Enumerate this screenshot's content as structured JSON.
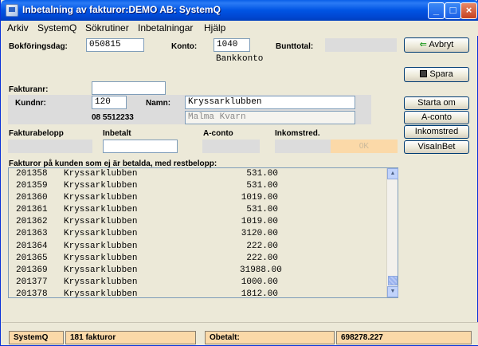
{
  "window": {
    "title": "Inbetalning av fakturor:DEMO AB: SystemQ"
  },
  "menu": [
    {
      "label": "Arkiv"
    },
    {
      "label": "SystemQ"
    },
    {
      "label": "Sökrutiner"
    },
    {
      "label": "Inbetalningar"
    },
    {
      "label": "Hjälp"
    }
  ],
  "form": {
    "bokforingsdag_label": "Bokföringsdag:",
    "bokforingsdag_value": "050815",
    "konto_label": "Konto:",
    "konto_value": "1040",
    "konto_name": "Bankkonto",
    "bunttotal_label": "Bunttotal:",
    "fakturanr_label": "Fakturanr:",
    "fakturanr_value": "",
    "kundnr_label": "Kundnr:",
    "kundnr_value": "120",
    "phone": "08 5512233",
    "namn_label": "Namn:",
    "namn_value": "Kryssarklubben",
    "address": "Malma Kvarn",
    "fakturabelopp_label": "Fakturabelopp",
    "inbetalt_label": "Inbetalt",
    "aconto_label": "A-conto",
    "inkomstred_label": "Inkomstred.",
    "ok_label": "0K"
  },
  "buttons": {
    "avbryt": "Avbryt",
    "spara": "Spara",
    "starta_om": "Starta om",
    "a_conto": "A-conto",
    "inkomstred": "Inkomstred",
    "visa_inbet": "VisaInBet"
  },
  "list": {
    "label": "Fakturor på kunden som ej är betalda, med restbelopp:",
    "rows": [
      [
        "201358",
        "Kryssarklubben",
        "531.00"
      ],
      [
        "201359",
        "Kryssarklubben",
        "531.00"
      ],
      [
        "201360",
        "Kryssarklubben",
        "1019.00"
      ],
      [
        "201361",
        "Kryssarklubben",
        "531.00"
      ],
      [
        "201362",
        "Kryssarklubben",
        "1019.00"
      ],
      [
        "201363",
        "Kryssarklubben",
        "3120.00"
      ],
      [
        "201364",
        "Kryssarklubben",
        "222.00"
      ],
      [
        "201365",
        "Kryssarklubben",
        "222.00"
      ],
      [
        "201369",
        "Kryssarklubben",
        "31988.00"
      ],
      [
        "201377",
        "Kryssarklubben",
        "1000.00"
      ],
      [
        "201378",
        "Kryssarklubben",
        "1812.00"
      ]
    ]
  },
  "status": {
    "app": "SystemQ",
    "count": "181 fakturor",
    "obetalt_label": "Obetalt:",
    "obetalt_value": "698278.227"
  },
  "colors": {
    "title_bar": "#0054e3",
    "status_panel": "#fbd9a8",
    "ok_button": "#fbd9a8",
    "readonly_field": "#dcdcdc"
  }
}
